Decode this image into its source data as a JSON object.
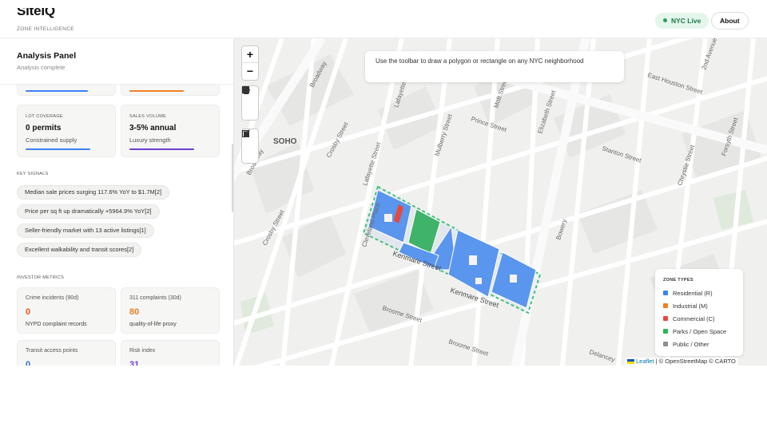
{
  "header": {
    "brand": "SiteIQ",
    "tagline": "ZONE INTELLIGENCE",
    "live_label": "NYC Live",
    "about_label": "About"
  },
  "panel": {
    "title": "Analysis Panel",
    "subtitle": "Analysis complete",
    "cards": [
      {
        "label": "LOT COVERAGE",
        "value": "0 permits",
        "sub": "Constrained supply",
        "bar_color": "#3b82f6",
        "fill": 0.78
      },
      {
        "label": "SALES VOLUME",
        "value": "3-5% annual",
        "sub": "Luxury strength",
        "bar_color": "#6d3fd1",
        "fill": 0.78
      }
    ],
    "top_bars": [
      {
        "color": "#3b82f6",
        "fill": 0.75
      },
      {
        "color": "#f07f22",
        "fill": 0.65
      }
    ],
    "key_signals_title": "KEY SIGNALS",
    "signals": [
      "Median sale prices surging 117.6% YoY to $1.7M[2]",
      "Price per sq ft up dramatically +5964.9% YoY[2]",
      "Seller-friendly market with 13 active listings[1]",
      "Excellent walkability and transit scores[2]"
    ],
    "investor_title": "INVESTOR METRICS",
    "metrics": [
      {
        "label": "Crime incidents (90d)",
        "value": "0",
        "sub": "NYPD complaint records",
        "color": "#f0541e"
      },
      {
        "label": "311 complaints (30d)",
        "value": "80",
        "sub": "quality-of-life proxy",
        "color": "#f07f22"
      },
      {
        "label": "Transit access points",
        "value": "0",
        "sub": "",
        "color": "#3b6fd8"
      },
      {
        "label": "Risk index",
        "value": "31",
        "sub": "",
        "color": "#6d3fd1"
      }
    ]
  },
  "map": {
    "hint": "Use the toolbar to draw a polygon or rectangle on any NYC neighborhood",
    "neighborhood": "SOHO",
    "streets": [
      "Prince Street",
      "Broadway",
      "Lafayette",
      "Mott Street",
      "Elizabeth Street",
      "Bowery",
      "East Houston Street",
      "2nd Avenue",
      "Chrystie Street",
      "Forsyth Street",
      "Stanton Street",
      "Crosby Street",
      "Mulberry Street",
      "Cleveland Place",
      "Kenmare Street",
      "Broome Street",
      "Delancey"
    ],
    "legend_title": "ZONE TYPES",
    "legend": [
      {
        "label": "Residential (R)",
        "color": "#3b82f6"
      },
      {
        "label": "Industrial (M)",
        "color": "#f07f22"
      },
      {
        "label": "Commercial (C)",
        "color": "#e5483c"
      },
      {
        "label": "Parks / Open Space",
        "color": "#2bb55a"
      },
      {
        "label": "Public / Other",
        "color": "#8e8e8e"
      }
    ],
    "attribution_leaflet": "Leaflet",
    "attribution_rest": "| © OpenStreetMap © CARTO"
  }
}
